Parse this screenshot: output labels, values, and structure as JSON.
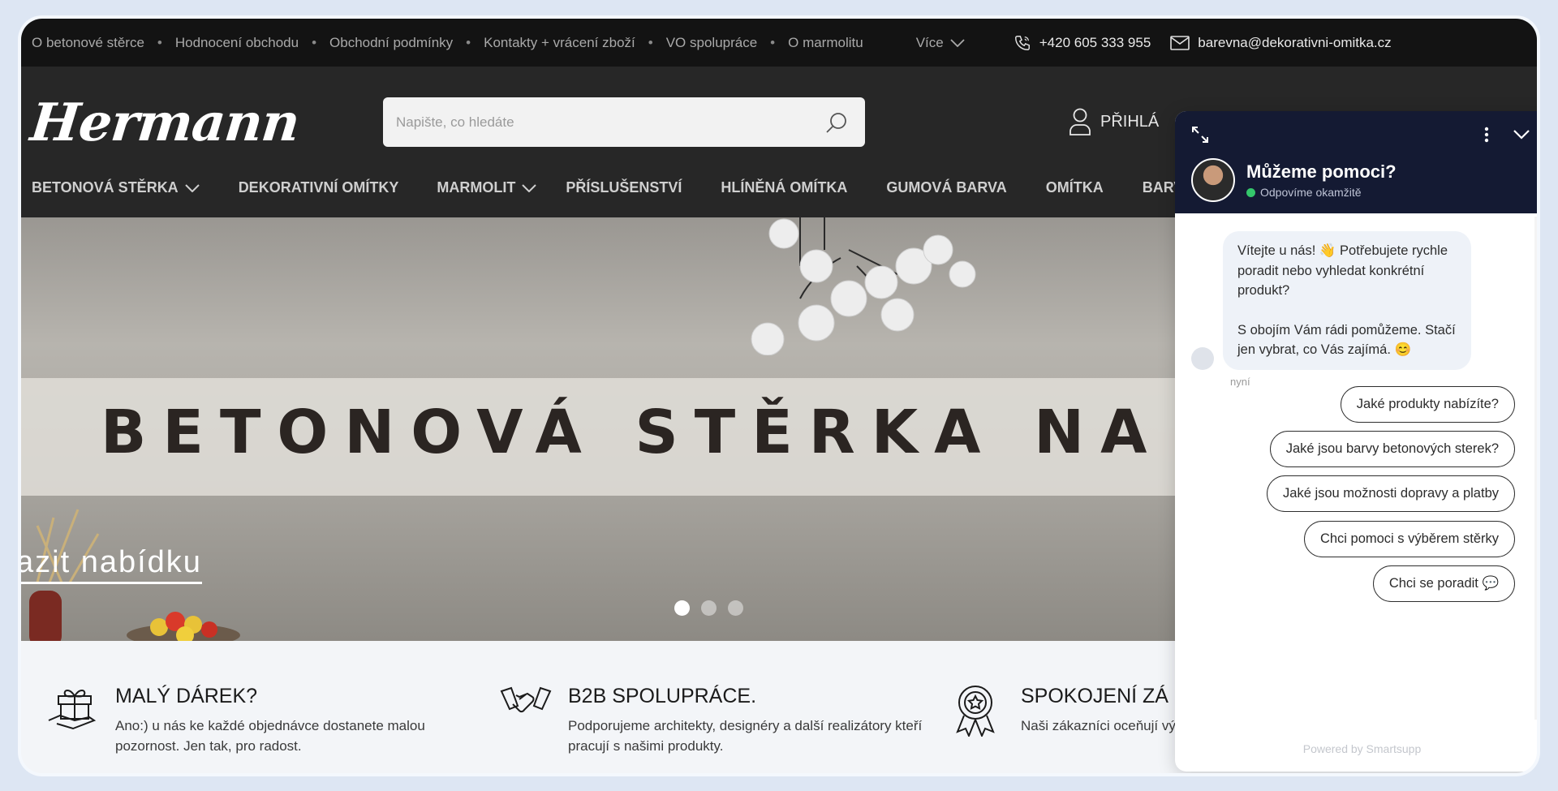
{
  "topbar": {
    "links": [
      "O betonové stěrce",
      "Hodnocení obchodu",
      "Obchodní podmínky",
      "Kontakty + vrácení zboží",
      "VO spolupráce",
      "O marmolitu"
    ],
    "more_label": "Více",
    "phone": "+420 605 333 955",
    "email": "barevna@dekorativni-omitka.cz"
  },
  "header": {
    "logo_text": "Hermann",
    "search_placeholder": "Napište, co hledáte",
    "login_label": "PŘIHLÁ"
  },
  "nav": {
    "items": [
      "BETONOVÁ STĚRKA",
      "DEKORATIVNÍ OMÍTKY",
      "MARMOLIT",
      "PŘÍSLUŠENSTVÍ",
      "HLÍNĚNÁ OMÍTKA",
      "GUMOVÁ BARVA",
      "OMÍTKA",
      "BARVY A"
    ]
  },
  "hero": {
    "headline": "BETONOVÁ STĚRKA NA ST",
    "cta": "azit nabídku",
    "slides": 3,
    "active_slide": 1
  },
  "features": [
    {
      "title": "MALÝ DÁREK?",
      "desc": "Ano:) u nás ke každé objednávce dostanete malou pozornost. Jen tak, pro radost.",
      "icon": "gift-icon"
    },
    {
      "title": "B2B SPOLUPRÁCE.",
      "desc": "Podporujeme architekty, designéry a další realizátory kteří pracují s našimi produkty.",
      "icon": "handshake-icon"
    },
    {
      "title": "SPOKOJENÍ ZÁ",
      "desc": "Naši zákazníci oceňují výjimečnou kvalitu pro poradí",
      "icon": "award-icon"
    }
  ],
  "chat": {
    "title": "Můžeme pomoci?",
    "status": "Odpovíme okamžitě",
    "message_line1": "Vítejte u nás! 👋 Potřebujete rychle poradit nebo vyhledat konkrétní produkt?",
    "message_line2": "S obojím Vám rádi pomůžeme. Stačí jen vybrat, co Vás zajímá. 😊",
    "time": "nyní",
    "quick_replies": [
      "Jaké produkty nabízíte?",
      "Jaké jsou barvy betonových sterek?",
      "Jaké jsou možnosti dopravy a platby",
      "Chci pomoci s výběrem stěrky",
      "Chci se poradit 💬"
    ],
    "powered": "Powered by Smartsupp"
  }
}
